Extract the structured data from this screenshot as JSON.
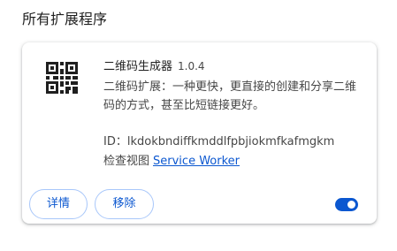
{
  "page": {
    "title": "所有扩展程序"
  },
  "extension": {
    "icon": "qr-code-icon",
    "name": "二维码生成器",
    "version": "1.0.4",
    "description": "二维码扩展：一种更快，更直接的创建和分享二维码的方式，甚至比短链接更好。",
    "id_text": "ID：lkdokbndiffkmddlfpbjiokmfkafmgkm",
    "views_label": "检查视图",
    "views_link": "Service Worker",
    "enabled": true
  },
  "actions": {
    "details_label": "详情",
    "remove_label": "移除"
  },
  "colors": {
    "accent": "#0b57d0",
    "button_border": "#a8c7fa",
    "text_primary": "#1f1f1f",
    "text_secondary": "#474747"
  }
}
